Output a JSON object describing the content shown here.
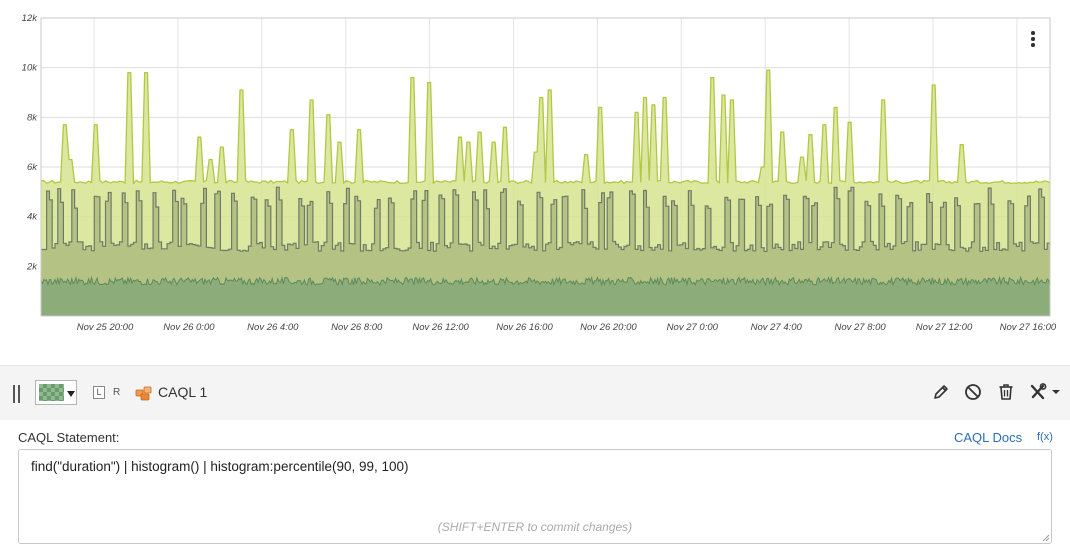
{
  "graph": {
    "menu_icon": "vertical-ellipsis-icon",
    "chart_data": {
      "type": "area",
      "x_range": [
        "2023-11-25 17:00",
        "2023-11-27 17:00"
      ],
      "x_tick_labels": [
        "Nov 25 20:00",
        "Nov 26 0:00",
        "Nov 26 4:00",
        "Nov 26 8:00",
        "Nov 26 12:00",
        "Nov 26 16:00",
        "Nov 26 20:00",
        "Nov 27 0:00",
        "Nov 27 4:00",
        "Nov 27 8:00",
        "Nov 27 12:00",
        "Nov 27 16:00"
      ],
      "y_tick_labels": [
        "2k",
        "4k",
        "6k",
        "8k",
        "10k",
        "12k"
      ],
      "ylim": [
        0,
        12000
      ],
      "grid": true,
      "series": [
        {
          "color": "#d6e38f",
          "stroke": "#b2c840",
          "baseline": 5400,
          "noise": 60,
          "spikes": [
            [
              2.3,
              7700
            ],
            [
              2.7,
              6300
            ],
            [
              5.3,
              7700
            ],
            [
              8.5,
              9800
            ],
            [
              10.2,
              9800
            ],
            [
              15.5,
              7200
            ],
            [
              16.8,
              6300
            ],
            [
              17.7,
              6800
            ],
            [
              19.8,
              9100
            ],
            [
              24.6,
              7500
            ],
            [
              26.6,
              8700
            ],
            [
              28.4,
              8100
            ],
            [
              29.4,
              7000
            ],
            [
              31.5,
              7500
            ],
            [
              36.8,
              9600
            ],
            [
              38.3,
              9400
            ],
            [
              41.4,
              7200
            ],
            [
              42.2,
              7000
            ],
            [
              43.4,
              7400
            ],
            [
              44.6,
              7000
            ],
            [
              45.7,
              7600
            ],
            [
              48.8,
              6600
            ],
            [
              49.4,
              8800
            ],
            [
              50.3,
              9100
            ],
            [
              53.9,
              6500
            ],
            [
              55.3,
              8400
            ],
            [
              58.8,
              8200
            ],
            [
              59.8,
              8800
            ],
            [
              60.6,
              8500
            ],
            [
              61.6,
              8800
            ],
            [
              66.4,
              9600
            ],
            [
              67.4,
              8900
            ],
            [
              68.2,
              8700
            ],
            [
              71.4,
              6000
            ],
            [
              71.9,
              9900
            ],
            [
              73.4,
              7400
            ],
            [
              75.2,
              6400
            ],
            [
              76.2,
              7300
            ],
            [
              77.4,
              7700
            ],
            [
              78.7,
              8400
            ],
            [
              80.0,
              7800
            ],
            [
              83.4,
              8700
            ],
            [
              88.4,
              9300
            ],
            [
              91.0,
              6900
            ]
          ]
        },
        {
          "color": "#afbe80",
          "stroke": "#6f7a67",
          "baseline": 2800,
          "pulses": 64,
          "pulse_high": 5200
        },
        {
          "color": "#8aac78",
          "stroke": "#5e8a5e",
          "baseline": 1400,
          "noise": 150
        }
      ]
    }
  },
  "toolbar": {
    "drag_handle_icon": "drag-handle-icon",
    "color_picker_icon": "checker-swatch-icon",
    "axis_left": "L",
    "axis_right": "R",
    "datasource_icon": "caql-source-icon",
    "datapoint_name": "CAQL 1",
    "actions": [
      "pencil-icon",
      "disable-icon",
      "trash-icon",
      "tools-dropdown-icon"
    ],
    "accent": "#2a6db5"
  },
  "caql": {
    "label": "CAQL Statement:",
    "docs_link": "CAQL Docs",
    "fx_link": "f(x)",
    "statement": "find(\"duration\") | histogram() | histogram:percentile(90, 99, 100)",
    "hint": "(SHIFT+ENTER to commit changes)"
  }
}
